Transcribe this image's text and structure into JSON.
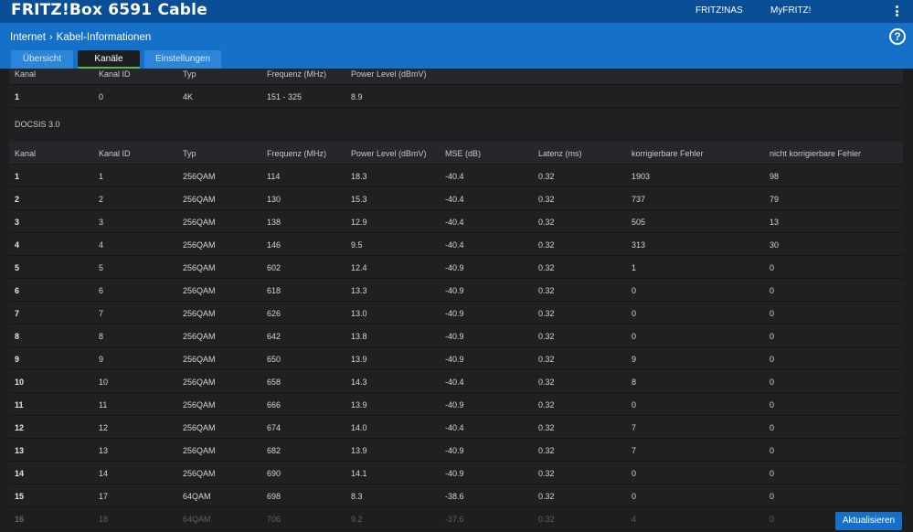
{
  "app": {
    "title": "FRITZ!Box 6591 Cable",
    "links": {
      "nas": "FRITZ!NAS",
      "myfritz": "MyFRITZ!"
    }
  },
  "breadcrumb": {
    "parent": "Internet",
    "separator": "›",
    "current": "Kabel-Informationen"
  },
  "help_label": "?",
  "tabs": [
    {
      "label": "Übersicht",
      "active": false
    },
    {
      "label": "Kanäle",
      "active": true
    },
    {
      "label": "Einstellungen",
      "active": false
    }
  ],
  "upstream_table": {
    "headers": [
      "Kanal",
      "Kanal ID",
      "Typ",
      "Frequenz (MHz)",
      "Power Level (dBmV)"
    ],
    "rows": [
      [
        "1",
        "0",
        "4K",
        "151 - 325",
        "8.9"
      ]
    ]
  },
  "docsis_table": {
    "section_title": "DOCSIS 3.0",
    "headers": [
      "Kanal",
      "Kanal ID",
      "Typ",
      "Frequenz (MHz)",
      "Power Level (dBmV)",
      "MSE (dB)",
      "Latenz (ms)",
      "korrigierbare Fehler",
      "nicht korrigierbare Fehler"
    ],
    "rows": [
      [
        "1",
        "1",
        "256QAM",
        "114",
        "18.3",
        "-40.4",
        "0.32",
        "1903",
        "98"
      ],
      [
        "2",
        "2",
        "256QAM",
        "130",
        "15.3",
        "-40.4",
        "0.32",
        "737",
        "79"
      ],
      [
        "3",
        "3",
        "256QAM",
        "138",
        "12.9",
        "-40.4",
        "0.32",
        "505",
        "13"
      ],
      [
        "4",
        "4",
        "256QAM",
        "146",
        "9.5",
        "-40.4",
        "0.32",
        "313",
        "30"
      ],
      [
        "5",
        "5",
        "256QAM",
        "602",
        "12.4",
        "-40.9",
        "0.32",
        "1",
        "0"
      ],
      [
        "6",
        "6",
        "256QAM",
        "618",
        "13.3",
        "-40.9",
        "0.32",
        "0",
        "0"
      ],
      [
        "7",
        "7",
        "256QAM",
        "626",
        "13.0",
        "-40.9",
        "0.32",
        "0",
        "0"
      ],
      [
        "8",
        "8",
        "256QAM",
        "642",
        "13.8",
        "-40.9",
        "0.32",
        "0",
        "0"
      ],
      [
        "9",
        "9",
        "256QAM",
        "650",
        "13.9",
        "-40.9",
        "0.32",
        "9",
        "0"
      ],
      [
        "10",
        "10",
        "256QAM",
        "658",
        "14.3",
        "-40.4",
        "0.32",
        "8",
        "0"
      ],
      [
        "11",
        "11",
        "256QAM",
        "666",
        "13.9",
        "-40.9",
        "0.32",
        "0",
        "0"
      ],
      [
        "12",
        "12",
        "256QAM",
        "674",
        "14.0",
        "-40.4",
        "0.32",
        "7",
        "0"
      ],
      [
        "13",
        "13",
        "256QAM",
        "682",
        "13.9",
        "-40.9",
        "0.32",
        "7",
        "0"
      ],
      [
        "14",
        "14",
        "256QAM",
        "690",
        "14.1",
        "-40.9",
        "0.32",
        "0",
        "0"
      ],
      [
        "15",
        "17",
        "64QAM",
        "698",
        "8.3",
        "-38.6",
        "0.32",
        "0",
        "0"
      ],
      [
        "16",
        "18",
        "64QAM",
        "706",
        "9.2",
        "-37.6",
        "0.32",
        "4",
        "0"
      ]
    ]
  },
  "refresh_label": "Aktualisieren",
  "colors": {
    "topbar": "#0a4f95",
    "subbar": "#1570c8",
    "active_tab_underline": "#5ab84f",
    "background": "#1d1e20"
  }
}
